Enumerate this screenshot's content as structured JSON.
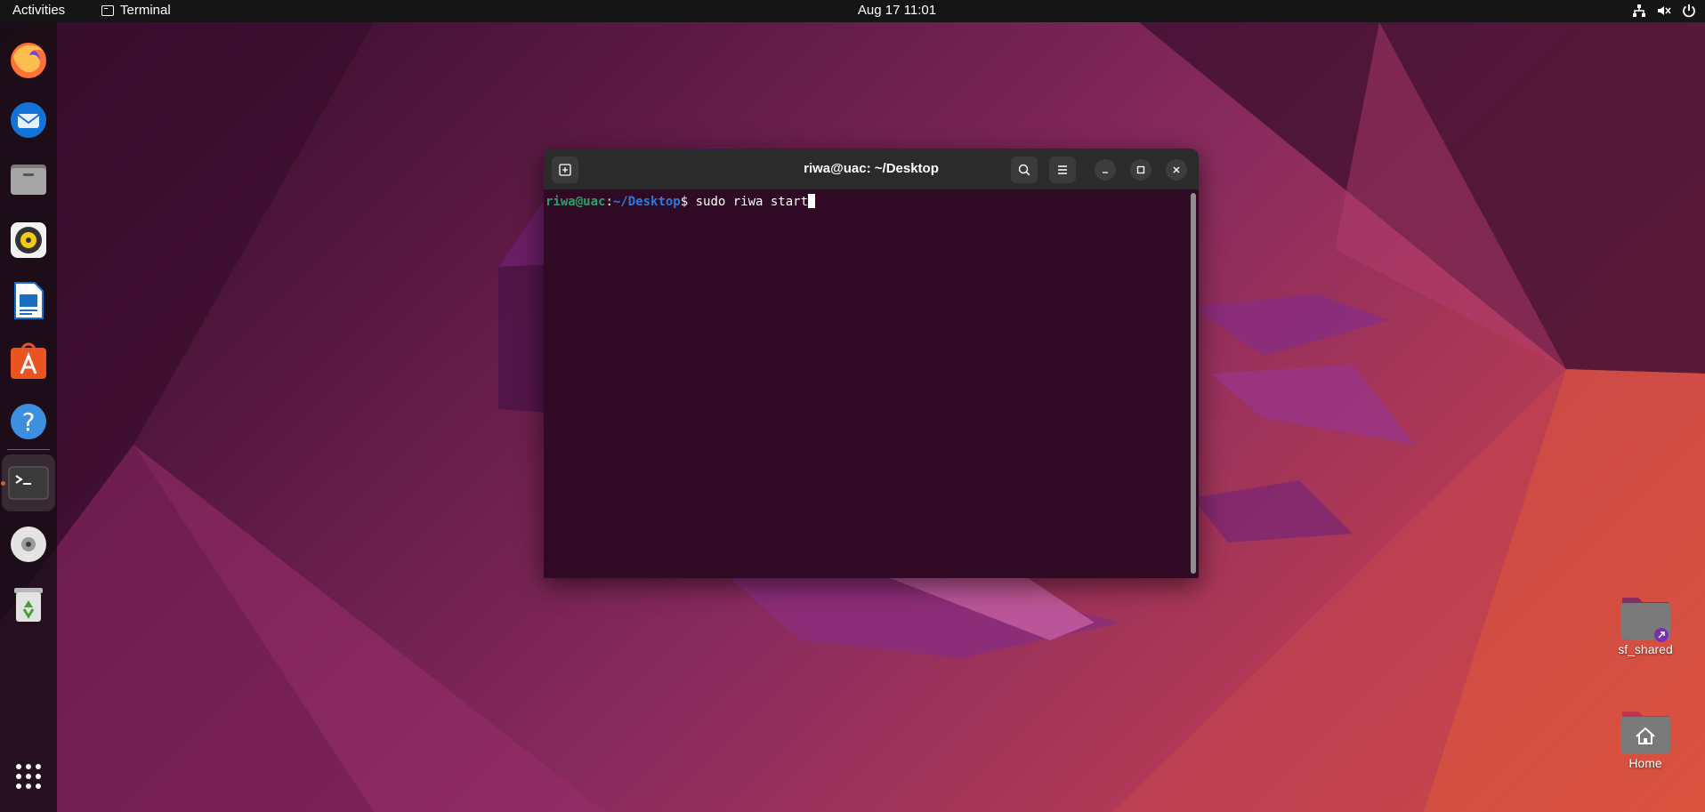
{
  "topbar": {
    "activities_label": "Activities",
    "app_name": "Terminal",
    "clock": "Aug 17  11:01",
    "tray_icons": [
      "network-icon",
      "volume-muted-icon",
      "power-icon"
    ]
  },
  "dock": {
    "items": [
      {
        "name": "firefox",
        "icon": "firefox-icon"
      },
      {
        "name": "thunderbird",
        "icon": "thunderbird-icon"
      },
      {
        "name": "files",
        "icon": "files-icon"
      },
      {
        "name": "rhythmbox",
        "icon": "rhythmbox-icon"
      },
      {
        "name": "libreoffice-writer",
        "icon": "writer-icon"
      },
      {
        "name": "app-center",
        "icon": "app-center-icon"
      },
      {
        "name": "help",
        "icon": "help-icon"
      },
      {
        "name": "terminal",
        "icon": "terminal-icon",
        "running": true
      },
      {
        "name": "dvd-drive",
        "icon": "disc-icon"
      },
      {
        "name": "trash",
        "icon": "trash-icon"
      }
    ],
    "show_apps_icon": "app-grid-icon"
  },
  "desktop": {
    "icons": [
      {
        "label": "sf_shared",
        "icon": "shared-folder-icon"
      },
      {
        "label": "Home",
        "icon": "home-folder-icon"
      }
    ]
  },
  "terminal": {
    "title": "riwa@uac: ~/Desktop",
    "prompt_user_host": "riwa@uac",
    "prompt_colon": ":",
    "prompt_path": "~/Desktop",
    "prompt_symbol": "$ ",
    "command": "sudo riwa start",
    "colors": {
      "background": "#300a24",
      "user": "#26a269",
      "path": "#2a7bde"
    }
  }
}
